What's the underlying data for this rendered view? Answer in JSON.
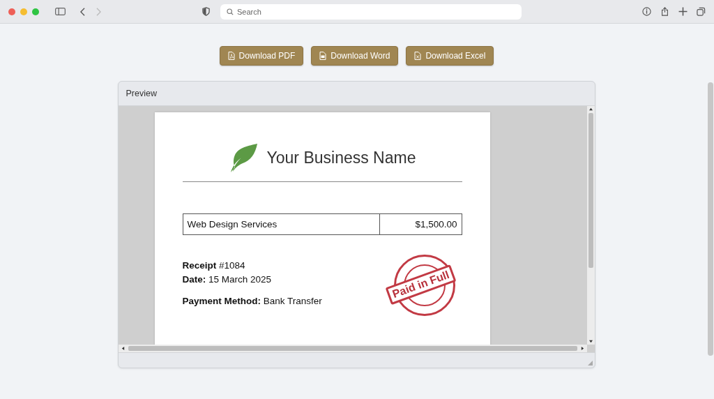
{
  "browser": {
    "search": {
      "placeholder": "Search"
    }
  },
  "downloads": [
    {
      "kind": "pdf",
      "label": "Download PDF"
    },
    {
      "kind": "word",
      "label": "Download Word"
    },
    {
      "kind": "excel",
      "label": "Download Excel"
    }
  ],
  "preview": {
    "title": "Preview",
    "document": {
      "business_name": "Your Business Name",
      "line_items": [
        {
          "description": "Web Design Services",
          "amount": "$1,500.00"
        }
      ],
      "details": [
        "**Receipt** #1084",
        "**Date:** 15 March 2025"
      ],
      "payment": "**Payment Method:** Bank Transfer",
      "stamp": "Paid in Full"
    }
  }
}
